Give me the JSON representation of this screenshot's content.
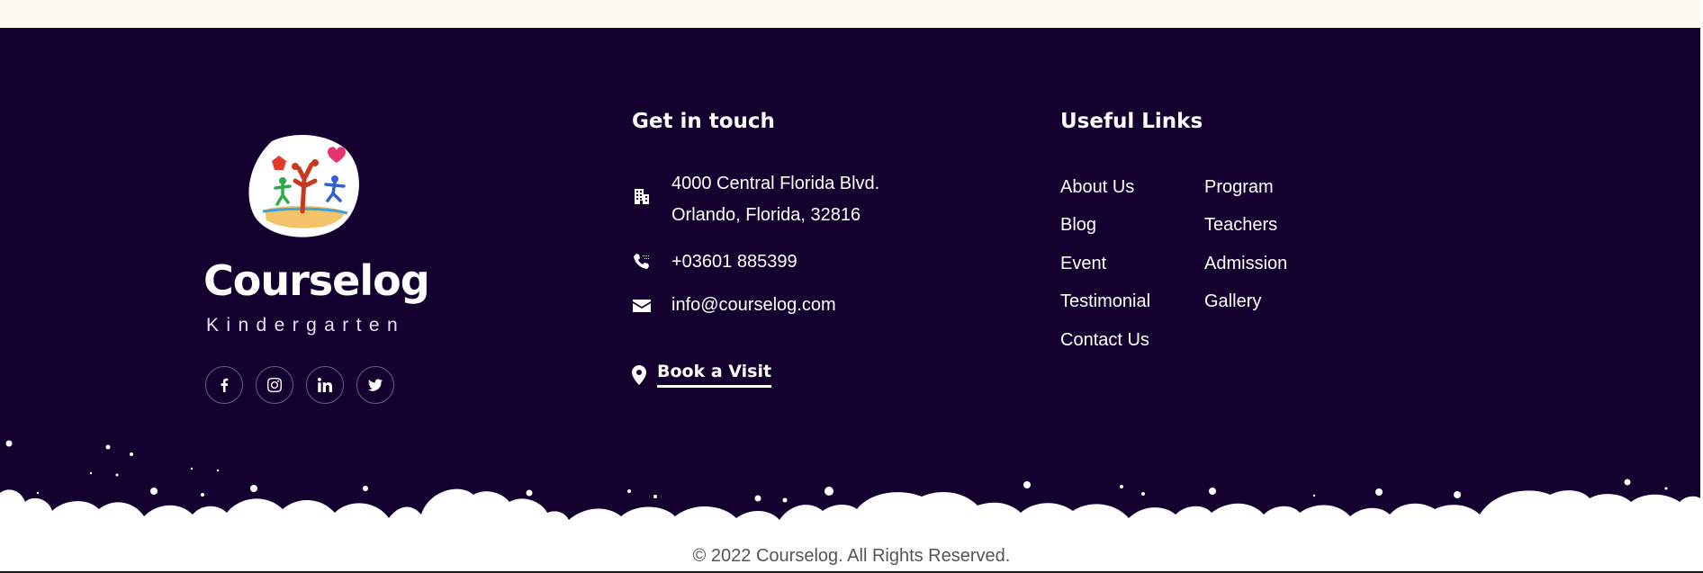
{
  "brand": {
    "name": "Courselog",
    "subtitle": "Kindergarten",
    "social": [
      {
        "icon": "facebook-icon"
      },
      {
        "icon": "instagram-icon"
      },
      {
        "icon": "linkedin-icon"
      },
      {
        "icon": "twitter-icon"
      }
    ]
  },
  "contact": {
    "title": "Get in touch",
    "address_line1": "4000 Central Florida Blvd.",
    "address_line2": "Orlando, Florida, 32816",
    "phone": "+03601 885399",
    "email": "info@courselog.com",
    "book_visit": "Book a Visit"
  },
  "links": {
    "title": "Useful Links",
    "col1": [
      "About Us",
      "Blog",
      "Event",
      "Testimonial",
      "Contact Us"
    ],
    "col2": [
      "Program",
      "Teachers",
      "Admission",
      "Gallery"
    ]
  },
  "copyright": "© 2022 Courselog. All Rights Reserved.",
  "colors": {
    "footer_bg": "#14002f",
    "top_bg": "#fffbf2",
    "text": "#ffffff",
    "copyright_text": "#555555"
  }
}
